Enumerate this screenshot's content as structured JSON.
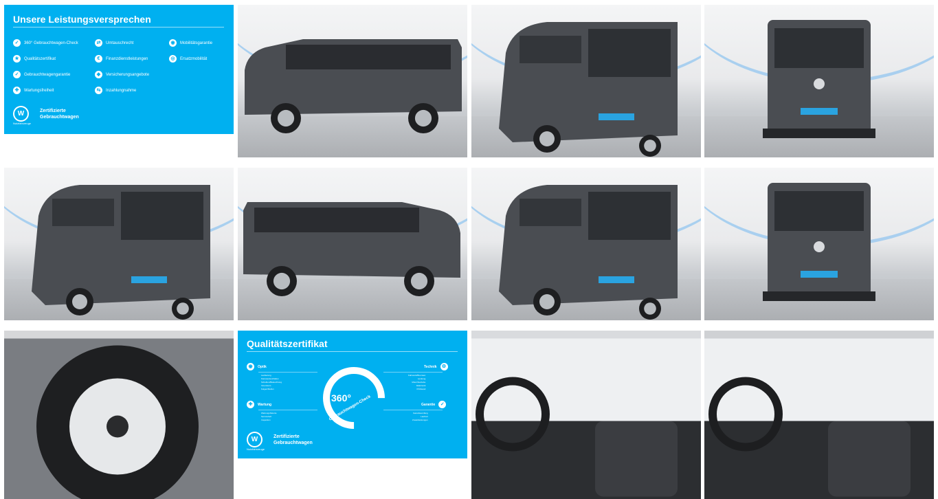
{
  "gallery": {
    "promo_services": {
      "title": "Unsere Leistungsversprechen",
      "items": [
        {
          "label": "360° Gebrauchtwagen-Check",
          "icon": "check-icon"
        },
        {
          "label": "Umtauschrecht",
          "icon": "exchange-icon"
        },
        {
          "label": "Mobilitätsgarantie",
          "icon": "car-icon"
        },
        {
          "label": "Qualitätszertifikat",
          "icon": "certificate-icon"
        },
        {
          "label": "Finanzdienstleistungen",
          "icon": "finance-icon"
        },
        {
          "label": "Ersatzmobilität",
          "icon": "replacement-car-icon"
        },
        {
          "label": "Gebrauchtwagengarantie",
          "icon": "warranty-icon"
        },
        {
          "label": "Versicherungsangebote",
          "icon": "insurance-icon"
        },
        {
          "label": "Wartungsfreiheit",
          "icon": "maintenance-icon"
        },
        {
          "label": "Inzahlungnahme",
          "icon": "trade-in-icon"
        }
      ],
      "badge_line1": "Zertifizierte",
      "badge_line2": "Gebrauchtwagen",
      "logo_caption": "Nutzfahrzeuge"
    },
    "promo_certificate": {
      "title": "Qualitätszertifikat",
      "center_label": "360°",
      "center_sub": "Gebrauchtwagen-Check",
      "sections": [
        {
          "label": "Optik",
          "items": [
            "Lackierung",
            "Karosserieschäden",
            "Scheiben/Beleuchtung",
            "Innenraum",
            "Felgen/Reifen"
          ]
        },
        {
          "label": "Technik",
          "items": [
            "Fahrwerk/Bremsen",
            "Lenkung",
            "Motor/Getriebe",
            "Elektronik",
            "Prüfstand"
          ]
        },
        {
          "label": "Wartung",
          "items": [
            "Wartungshistorie",
            "Serviceheft",
            "Inspektion"
          ]
        },
        {
          "label": "Garantie",
          "items": [
            "Garantieumfang",
            "Laufzeit",
            "Zusatzleistungen"
          ]
        }
      ],
      "badge_line1": "Zertifizierte",
      "badge_line2": "Gebrauchtwagen",
      "logo_caption": "Nutzfahrzeuge"
    },
    "photos": [
      {
        "name": "photo-side-left",
        "view": "side-left"
      },
      {
        "name": "photo-rear-three-quarter-left",
        "view": "rear-left"
      },
      {
        "name": "photo-rear",
        "view": "rear"
      },
      {
        "name": "photo-rear-three-quarter-right",
        "view": "rear-right"
      },
      {
        "name": "photo-side-right",
        "view": "side-right"
      },
      {
        "name": "photo-front-three-quarter",
        "view": "front-right"
      },
      {
        "name": "photo-front",
        "view": "front"
      },
      {
        "name": "photo-wheel",
        "view": "wheel"
      },
      {
        "name": "photo-interior-dashboard",
        "view": "dashboard"
      },
      {
        "name": "photo-interior-cabin",
        "view": "cabin"
      }
    ],
    "colors": {
      "brand_blue": "#00b0f0",
      "van_body": "#4a4d52"
    }
  }
}
